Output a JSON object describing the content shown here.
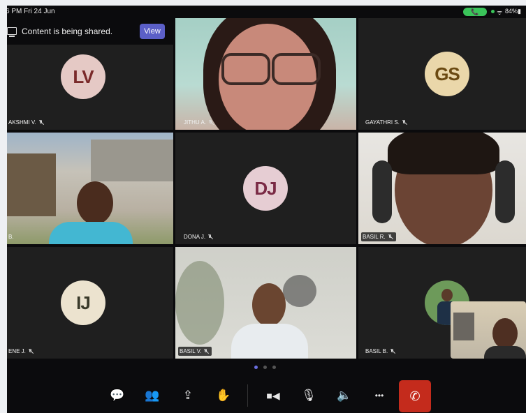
{
  "status_bar": {
    "time_date": "6 PM   Fri 24 Jun",
    "call_pill": "📞",
    "wifi": "ᯤ",
    "battery": "84%▮"
  },
  "share_banner": {
    "message": "Content is being shared.",
    "view_label": "View"
  },
  "participants": [
    {
      "initials": "LV",
      "name": "AKSHMI V.",
      "avatar_bg": "#e5c9c5",
      "avatar_fg": "#7a2a2a"
    },
    {
      "name": "JITHU A."
    },
    {
      "initials": "GS",
      "name": "GAYATHRI S.",
      "avatar_bg": "#ead7aa",
      "avatar_fg": "#6b4a12"
    },
    {
      "name": "B."
    },
    {
      "initials": "DJ",
      "name": "DONA J.",
      "avatar_bg": "#e6cdd3",
      "avatar_fg": "#7a2a45"
    },
    {
      "name": "BASIL R."
    },
    {
      "initials": "IJ",
      "name": "ENE J.",
      "avatar_bg": "#ece3cf",
      "avatar_fg": "#3a3a2a"
    },
    {
      "name": "BASIL V."
    },
    {
      "name": "BASIL B."
    }
  ],
  "page_indicator": {
    "current": 1,
    "total": 3
  },
  "toolbar": {
    "chat_icon": "💬",
    "people_icon": "👥",
    "share_icon": "⇪",
    "react_icon": "✋",
    "camera_icon": "■◀",
    "mic_icon": "🎙",
    "speaker_icon": "🔈",
    "more_icon": "•••",
    "end_icon": "✆"
  },
  "colors": {
    "accent": "#5b5fc7",
    "end_call": "#c42b1c",
    "tile": "#1f1f1f"
  }
}
